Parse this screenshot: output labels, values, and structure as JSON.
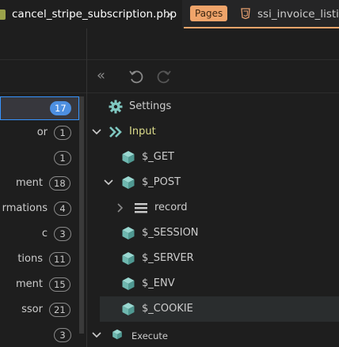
{
  "tabs": [
    {
      "label": "cancel_stripe_subscription.php",
      "close": "×",
      "active": true
    },
    {
      "label": "ssi_invoice_listing",
      "active": false
    }
  ],
  "pages_badge": "Pages",
  "left_list": [
    {
      "label": "",
      "count": "17",
      "selected": true
    },
    {
      "label": "or",
      "count": "1"
    },
    {
      "label": "",
      "count": "1"
    },
    {
      "label": "ment",
      "count": "18"
    },
    {
      "label": "rmations",
      "count": "4"
    },
    {
      "label": "c",
      "count": "3"
    },
    {
      "label": "tions",
      "count": "11"
    },
    {
      "label": "ment",
      "count": "15"
    },
    {
      "label": "ssor",
      "count": "21"
    },
    {
      "label": "",
      "count": "3"
    }
  ],
  "toolbar": {
    "collapse": "«"
  },
  "tree": [
    {
      "label": "Settings",
      "icon": "gear-icon"
    },
    {
      "label": "Input",
      "icon": "double-chevron-icon",
      "expanded": true
    },
    {
      "label": "$_GET",
      "icon": "cube-icon"
    },
    {
      "label": "$_POST",
      "icon": "cube-icon",
      "expanded": true
    },
    {
      "label": "record",
      "icon": "list-icon",
      "expanded": false
    },
    {
      "label": "$_SESSION",
      "icon": "cube-icon"
    },
    {
      "label": "$_SERVER",
      "icon": "cube-icon"
    },
    {
      "label": "$_ENV",
      "icon": "cube-icon"
    },
    {
      "label": "$_COOKIE",
      "icon": "cube-icon",
      "hover": true
    },
    {
      "label": "Execute",
      "icon": "cube-icon",
      "expanded": true
    }
  ],
  "colors": {
    "accent": "#3794ff",
    "cube": "#7fc7c0",
    "input": "#dcdc8b",
    "pages": "#f0a46a"
  }
}
